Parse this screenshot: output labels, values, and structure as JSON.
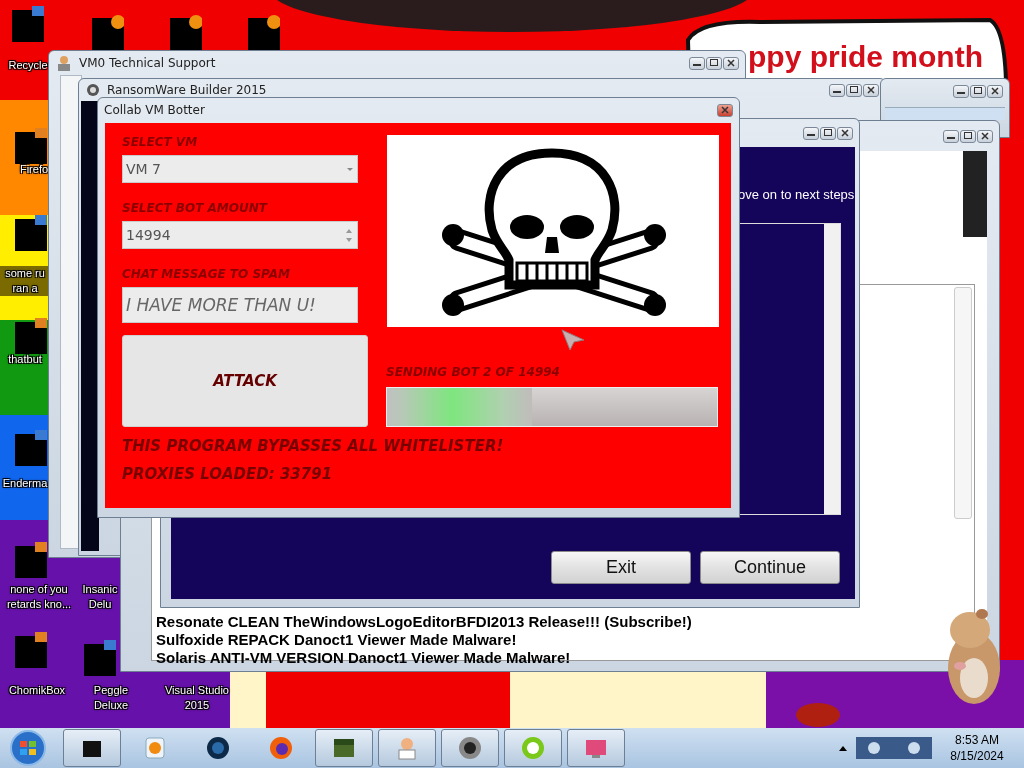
{
  "desktop": {
    "banner": "ppy pride month",
    "icons": [
      {
        "label": "Recycle"
      },
      {
        "label": "Firefo"
      },
      {
        "label": "some ru\nran a"
      },
      {
        "label": "thatbut"
      },
      {
        "label": "Enderma"
      },
      {
        "label": "none of you retards kno..."
      },
      {
        "label": "Insanic\nDelu"
      },
      {
        "label": "ChomikBox"
      },
      {
        "label": "Peggle Deluxe"
      },
      {
        "label": "Visual Studio 2015"
      }
    ]
  },
  "vm0_window": {
    "title": "VM0 Technical Support"
  },
  "ransomware_window": {
    "title": "RansomWare Builder 2015"
  },
  "list_window": {
    "lines": [
      "Resonate CLEAN TheWindowsLogoEditorBFDI2013 Release!!! (Subscribe!)",
      "Sulfoxide REPACK Danoct1 Viewer Made Malware!",
      "Solaris ANTI-VM VERSION Danoct1 Viewer Made Malware!"
    ]
  },
  "installer_window": {
    "text": "ove on to next steps",
    "buttons": [
      "Exit",
      "Continue"
    ]
  },
  "botter_window": {
    "title": "Collab VM Botter",
    "vm_label": "SELECT VM",
    "vm_value": "VM 7",
    "bot_amount_label": "SELECT BOT AMOUNT",
    "bot_amount_value": "14994",
    "chat_label": "CHAT MESSAGE TO SPAM",
    "chat_value": "I HAVE MORE THAN U!",
    "attack_button": "ATTACK",
    "progress_label": "SENDING BOT 2 OF 14994",
    "progress": {
      "level": 0.44
    },
    "notice": "THIS PROGRAM BYPASSES ALL WHITELISTER!",
    "proxies": "PROXIES LOADED: 33791"
  },
  "taskbar": {
    "items": [
      {
        "running": true
      },
      {
        "running": false
      },
      {
        "running": false
      },
      {
        "running": false
      },
      {
        "running": true
      },
      {
        "running": true
      },
      {
        "running": true
      },
      {
        "running": true
      },
      {
        "running": true
      }
    ],
    "clock_time": "8:53 AM",
    "clock_date": "8/15/2024"
  }
}
